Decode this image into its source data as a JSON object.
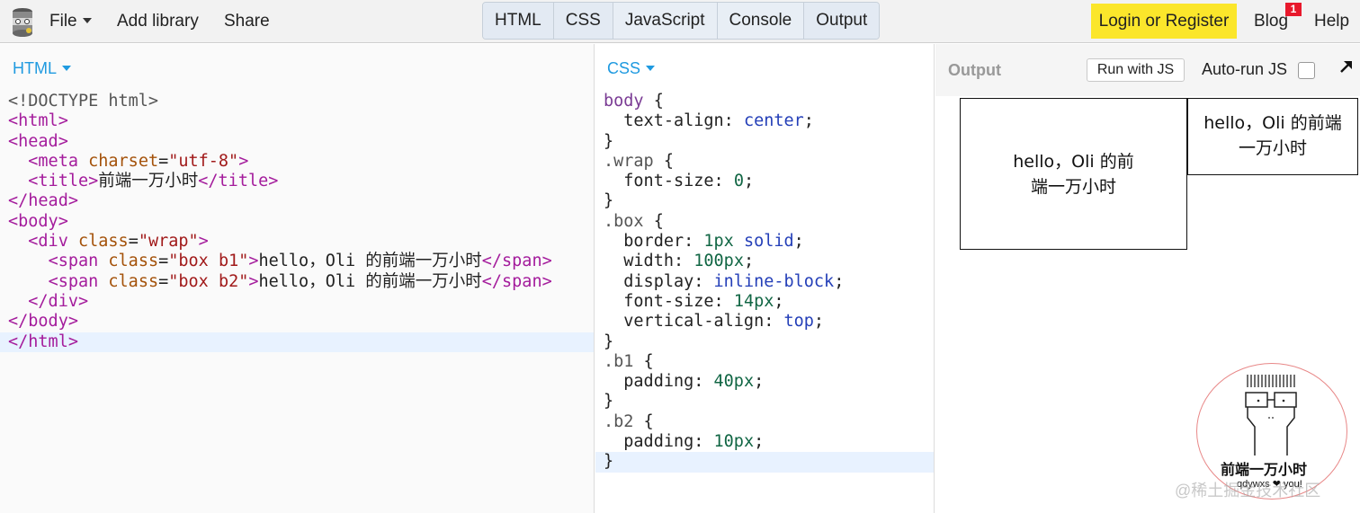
{
  "topbar": {
    "menu": [
      {
        "label": "File"
      },
      {
        "label": "Add library"
      },
      {
        "label": "Share"
      }
    ],
    "tabs": [
      "HTML",
      "CSS",
      "JavaScript",
      "Console",
      "Output"
    ],
    "login_label": "Login or Register",
    "blog_label": "Blog",
    "blog_badge": "1",
    "help_label": "Help",
    "accent_color": "#fbe62b"
  },
  "html_pane": {
    "header": "HTML",
    "lines": [
      "<!DOCTYPE html>",
      "<html>",
      "<head>",
      "  <meta charset=\"utf-8\">",
      "  <title>前端一万小时</title>",
      "</head>",
      "<body>",
      "  <div class=\"wrap\">",
      "    <span class=\"box b1\">hello，Oli 的前端一万小时</span>",
      "    <span class=\"box b2\">hello，Oli 的前端一万小时</span>",
      "  </div>",
      "</body>",
      "</html>"
    ]
  },
  "css_pane": {
    "header": "CSS",
    "lines": [
      "body {",
      "  text-align: center;",
      "}",
      ".wrap {",
      "  font-size: 0;",
      "}",
      ".box {",
      "  border: 1px solid;",
      "  width: 100px;",
      "  display: inline-block;",
      "  font-size: 14px;",
      "  vertical-align: top;",
      "}",
      ".b1 {",
      "  padding: 40px;",
      "}",
      ".b2 {",
      "  padding: 10px;",
      "}"
    ]
  },
  "output_pane": {
    "title": "Output",
    "run_label": "Run with JS",
    "autorun_label": "Auto-run JS",
    "autorun_checked": false,
    "box1_text": "hello，Oli 的前端一万小时",
    "box2_text": "hello，Oli 的前端一万小时"
  },
  "watermark": {
    "stamp_title": "前端一万小时",
    "stamp_sub": "qdywxs ❤ you!",
    "site": "@稀土掘金技术社区"
  }
}
